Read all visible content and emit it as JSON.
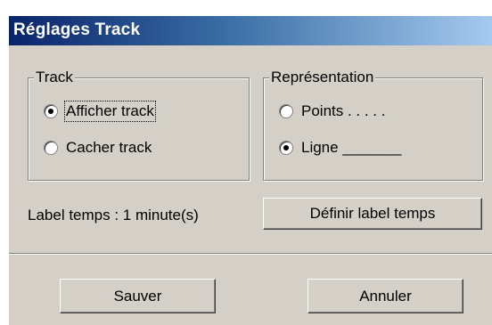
{
  "window": {
    "title": "Réglages Track"
  },
  "track_group": {
    "legend": "Track",
    "options": [
      {
        "label": "Afficher track",
        "checked": true
      },
      {
        "label": "Cacher track",
        "checked": false
      }
    ]
  },
  "representation_group": {
    "legend": "Représentation",
    "options": [
      {
        "label": "Points . . . . .",
        "checked": false
      },
      {
        "label": "Ligne _______",
        "checked": true
      }
    ]
  },
  "time_label": "Label temps : 1 minute(s)",
  "buttons": {
    "define_label": "Définir label temps",
    "save": "Sauver",
    "cancel": "Annuler"
  }
}
